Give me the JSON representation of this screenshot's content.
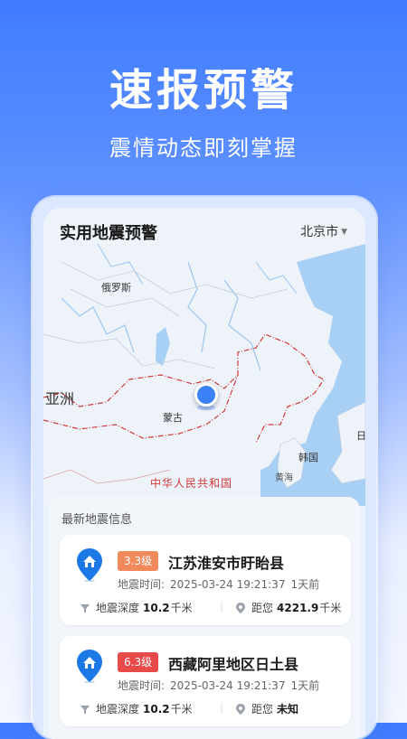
{
  "hero": {
    "title": "速报预警",
    "subtitle": "震情动态即刻掌握"
  },
  "app": {
    "title": "实用地震预警",
    "city": "北京市"
  },
  "map": {
    "labels": {
      "russia": "俄罗斯",
      "asia": "亚洲",
      "mongolia": "蒙古",
      "china": "中华人民共和国",
      "korea": "韩国",
      "yellow_sea": "黄海",
      "japan": "日"
    }
  },
  "list": {
    "title": "最新地震信息",
    "items": [
      {
        "magnitude": "3.3级",
        "magnitude_color": "#f08a5d",
        "place": "江苏淮安市盱眙县",
        "time_label": "地震时间:",
        "time": "2025-03-24 19:21:37",
        "ago": "1天前",
        "depth_label": "地震深度",
        "depth_value": "10.2",
        "depth_unit": "千米",
        "distance_label": "距您",
        "distance_value": "4221.9",
        "distance_unit": "千米"
      },
      {
        "magnitude": "6.3级",
        "magnitude_color": "#e84a4a",
        "place": "西藏阿里地区日土县",
        "time_label": "地震时间:",
        "time": "2025-03-24 19:21:37",
        "ago": "1天前",
        "depth_label": "地震深度",
        "depth_value": "10.2",
        "depth_unit": "千米",
        "distance_label": "距您",
        "distance_value": "未知",
        "distance_unit": ""
      }
    ]
  },
  "colors": {
    "accent": "#3b82f6",
    "china_border": "#d13a3a",
    "sea": "#a8d0f5"
  },
  "icons": {
    "pin": "house-pin-icon",
    "depth": "depth-icon",
    "distance": "location-icon",
    "city_caret": "caret-down-icon"
  }
}
